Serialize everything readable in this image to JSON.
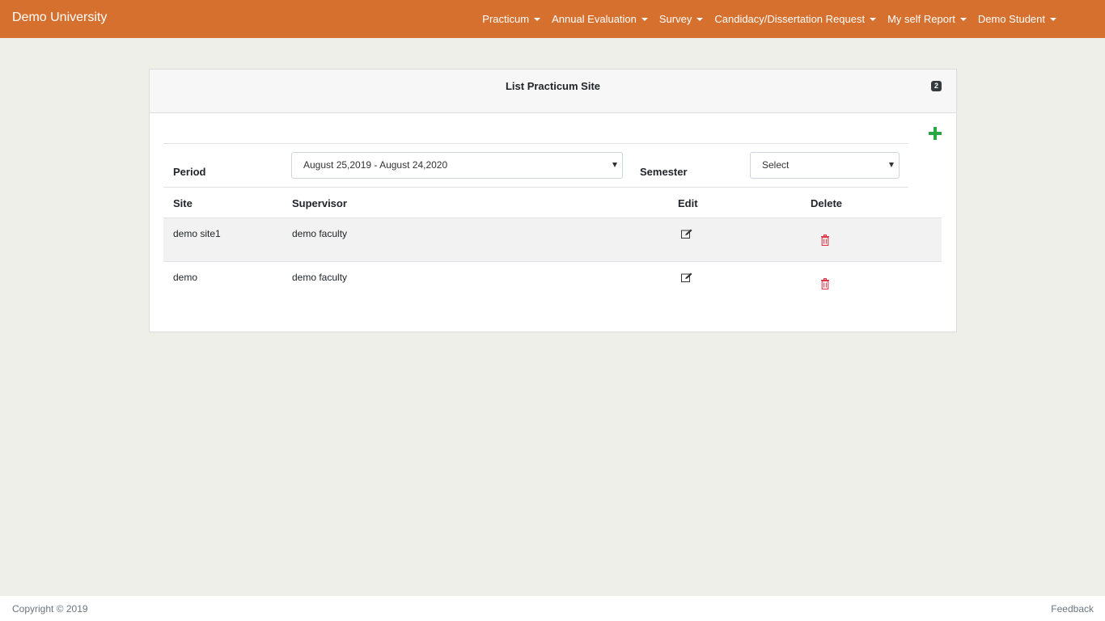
{
  "navbar": {
    "brand": "Demo University",
    "menus": [
      {
        "label": "Practicum"
      },
      {
        "label": "Annual Evaluation"
      },
      {
        "label": "Survey"
      },
      {
        "label": "Candidacy/Dissertation Request"
      },
      {
        "label": "My self Report"
      },
      {
        "label": "Demo Student"
      }
    ]
  },
  "card": {
    "title": "List Practicum Site",
    "count": "2",
    "filters": {
      "period_label": "Period",
      "period_value": "August 25,2019 - August 24,2020",
      "semester_label": "Semester",
      "semester_value": "Select"
    },
    "columns": {
      "site": "Site",
      "supervisor": "Supervisor",
      "edit": "Edit",
      "delete": "Delete"
    },
    "rows": [
      {
        "site": "demo site1",
        "supervisor": "demo faculty"
      },
      {
        "site": "demo",
        "supervisor": "demo faculty"
      }
    ]
  },
  "icons": {
    "add": "plus-icon",
    "edit": "edit-icon",
    "delete": "trash-icon"
  },
  "colors": {
    "navbar": "#d6702f",
    "add": "#28a745",
    "delete": "#dc3545",
    "badge": "#343a40"
  },
  "footer": {
    "copyright": "Copyright © 2019",
    "feedback": "Feedback"
  }
}
